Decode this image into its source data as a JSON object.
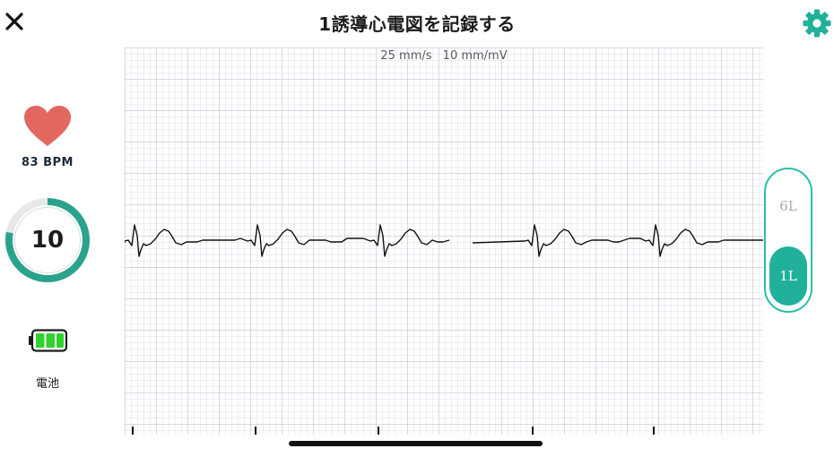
{
  "header": {
    "title": "1誘導心電図を記録する"
  },
  "ecg": {
    "paper_speed": "25 mm/s",
    "gain": "10 mm/mV"
  },
  "vitals": {
    "bpm_label": "83 BPM",
    "timer_value": "10",
    "timer_progress": 0.78,
    "battery_label": "電池",
    "battery_bars_filled": 3
  },
  "leads": {
    "option_6l": "6L",
    "option_1l": "1L",
    "selected": "1L"
  },
  "colors": {
    "accent": "#21b19a",
    "heart": "#e2675f",
    "battery": "#2fd22a"
  },
  "icons": {
    "close": "close-icon",
    "settings": "gear-icon",
    "heart": "heart-icon",
    "battery": "battery-icon"
  }
}
